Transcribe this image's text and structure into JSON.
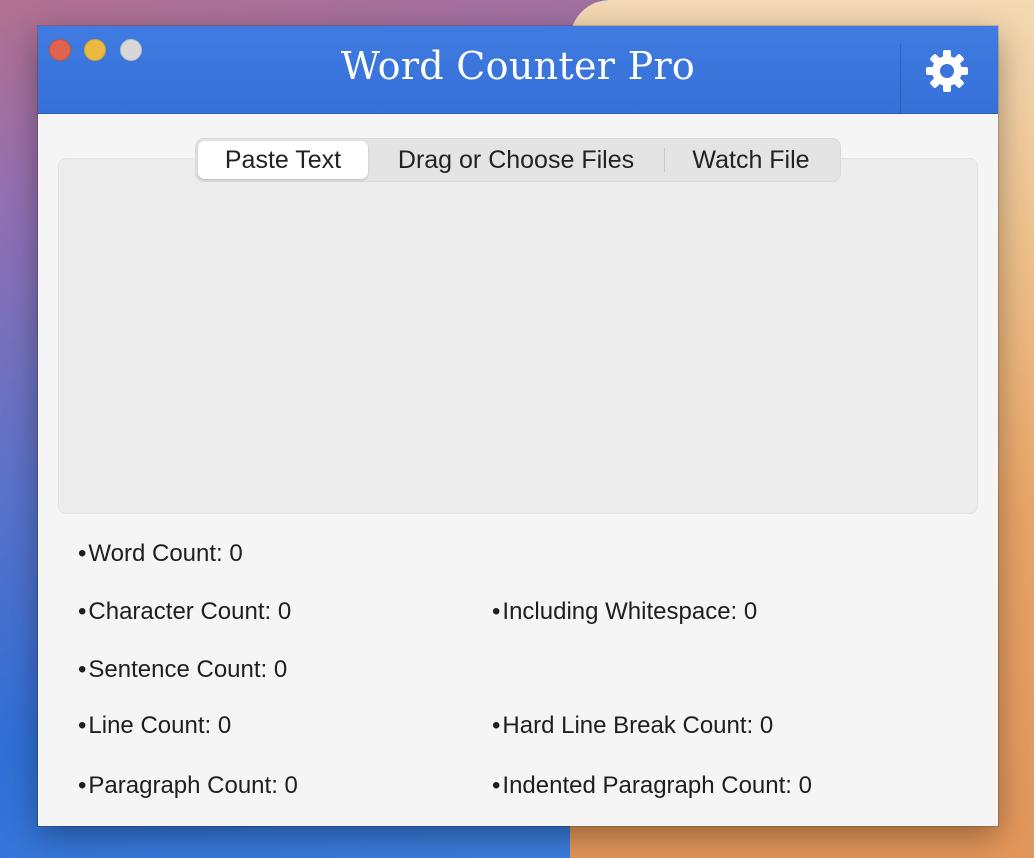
{
  "window": {
    "title": "Word Counter Pro"
  },
  "tabs": [
    {
      "label": "Paste Text",
      "active": true
    },
    {
      "label": "Drag or Choose Files",
      "active": false
    },
    {
      "label": "Watch File",
      "active": false
    }
  ],
  "text_area": {
    "value": ""
  },
  "stats": {
    "bullet": "•",
    "word_count": "Word Count: 0",
    "character_count": "Character Count: 0",
    "including_whitespace": "Including Whitespace: 0",
    "sentence_count": "Sentence Count: 0",
    "line_count": "Line Count: 0",
    "hard_line_break_count": "Hard Line Break Count: 0",
    "paragraph_count": "Paragraph Count: 0",
    "indented_paragraph_count": "Indented Paragraph Count: 0"
  },
  "icons": {
    "settings": "gear-icon"
  },
  "colors": {
    "titlebar": "#3a74dc",
    "close": "#e0634f",
    "minimize": "#e9b942",
    "zoom": "#d7d7d7"
  }
}
